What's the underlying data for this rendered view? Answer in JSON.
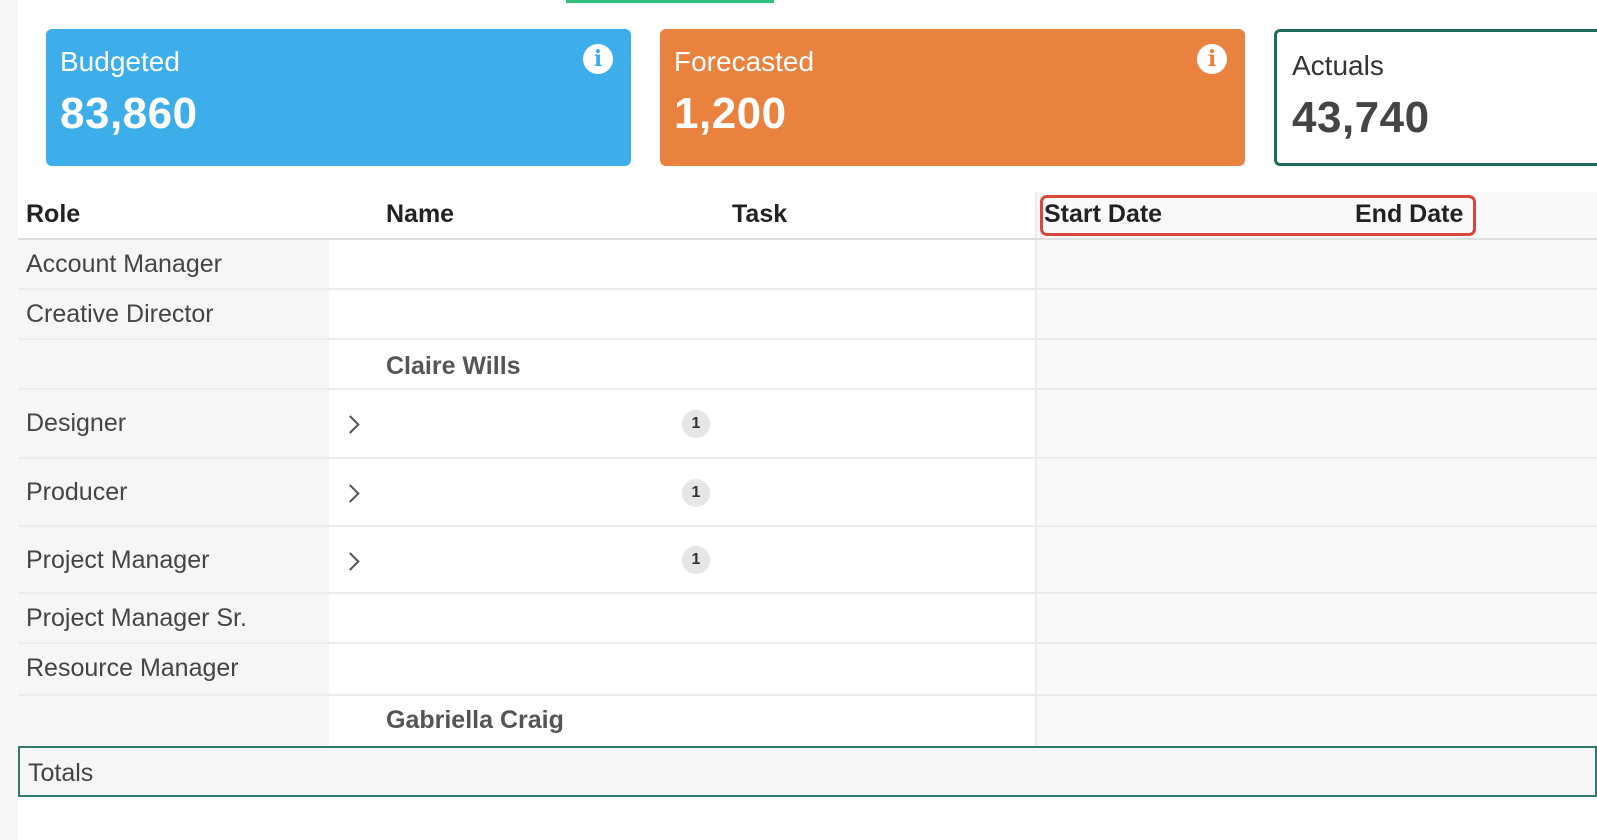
{
  "summary": {
    "budgeted": {
      "label": "Budgeted",
      "value": "83,860",
      "icon": "info-icon"
    },
    "forecasted": {
      "label": "Forecasted",
      "value": "1,200",
      "icon": "info-icon"
    },
    "actuals": {
      "label": "Actuals",
      "value": "43,740"
    }
  },
  "colors": {
    "budgeted": "#3daee9",
    "forecasted": "#e8823e",
    "actuals_border": "#1f6b5b",
    "highlight": "#d9463b",
    "tab_indicator": "#2ec27e"
  },
  "table": {
    "columns": {
      "role": "Role",
      "name": "Name",
      "task": "Task",
      "start_date": "Start Date",
      "end_date": "End Date"
    },
    "rows": [
      {
        "role": "Account Manager",
        "name": "",
        "expandable": false,
        "count": ""
      },
      {
        "role": "Creative Director",
        "name": "",
        "expandable": false,
        "count": ""
      },
      {
        "role": "",
        "name": "Claire Wills",
        "expandable": false,
        "count": ""
      },
      {
        "role": "Designer",
        "name": "",
        "expandable": true,
        "count": "1"
      },
      {
        "role": "Producer",
        "name": "",
        "expandable": true,
        "count": "1"
      },
      {
        "role": "Project Manager",
        "name": "",
        "expandable": true,
        "count": "1"
      },
      {
        "role": "Project Manager Sr.",
        "name": "",
        "expandable": false,
        "count": ""
      },
      {
        "role": "Resource Manager",
        "name": "",
        "expandable": false,
        "count": ""
      },
      {
        "role": "",
        "name": "Gabriella Craig",
        "expandable": false,
        "count": ""
      }
    ],
    "totals_label": "Totals"
  }
}
